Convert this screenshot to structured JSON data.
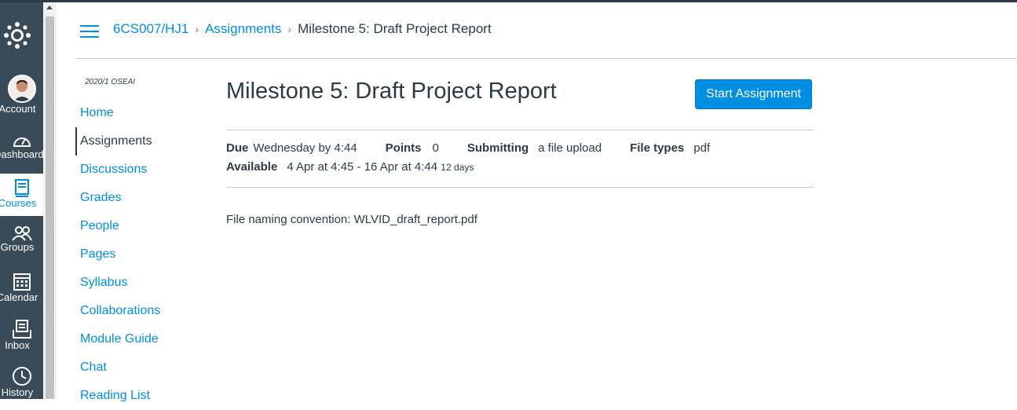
{
  "global_nav": {
    "items": [
      {
        "label": "Account",
        "icon": "account-avatar"
      },
      {
        "label": "Dashboard",
        "icon": "dashboard-icon"
      },
      {
        "label": "Courses",
        "icon": "courses-icon"
      },
      {
        "label": "Groups",
        "icon": "groups-icon"
      },
      {
        "label": "Calendar",
        "icon": "calendar-icon"
      },
      {
        "label": "Inbox",
        "icon": "inbox-icon"
      },
      {
        "label": "History",
        "icon": "history-icon"
      }
    ],
    "accent": "#008ee2",
    "background": "#394b58"
  },
  "breadcrumb": {
    "course": "6CS007/HJ1",
    "section": "Assignments",
    "current": "Milestone 5: Draft Project Report"
  },
  "course_nav": {
    "term": "2020/1 OSEAI",
    "items": [
      {
        "label": "Home"
      },
      {
        "label": "Assignments"
      },
      {
        "label": "Discussions"
      },
      {
        "label": "Grades"
      },
      {
        "label": "People"
      },
      {
        "label": "Pages"
      },
      {
        "label": "Syllabus"
      },
      {
        "label": "Collaborations"
      },
      {
        "label": "Module Guide"
      },
      {
        "label": "Chat"
      },
      {
        "label": "Reading List"
      }
    ],
    "active": "Assignments"
  },
  "assignment": {
    "title": "Milestone 5: Draft Project Report",
    "start_button": "Start Assignment",
    "due_label": "Due",
    "due_value": "Wednesday by 4:44",
    "points_label": "Points",
    "points_value": "0",
    "submitting_label": "Submitting",
    "submitting_value": "a file upload",
    "file_types_label": "File types",
    "file_types_value": "pdf",
    "available_label": "Available",
    "available_value": "4 Apr at 4:45 - 16 Apr at 4:44",
    "available_duration": "12 days",
    "description": "File naming convention: WLVID_draft_report.pdf"
  }
}
